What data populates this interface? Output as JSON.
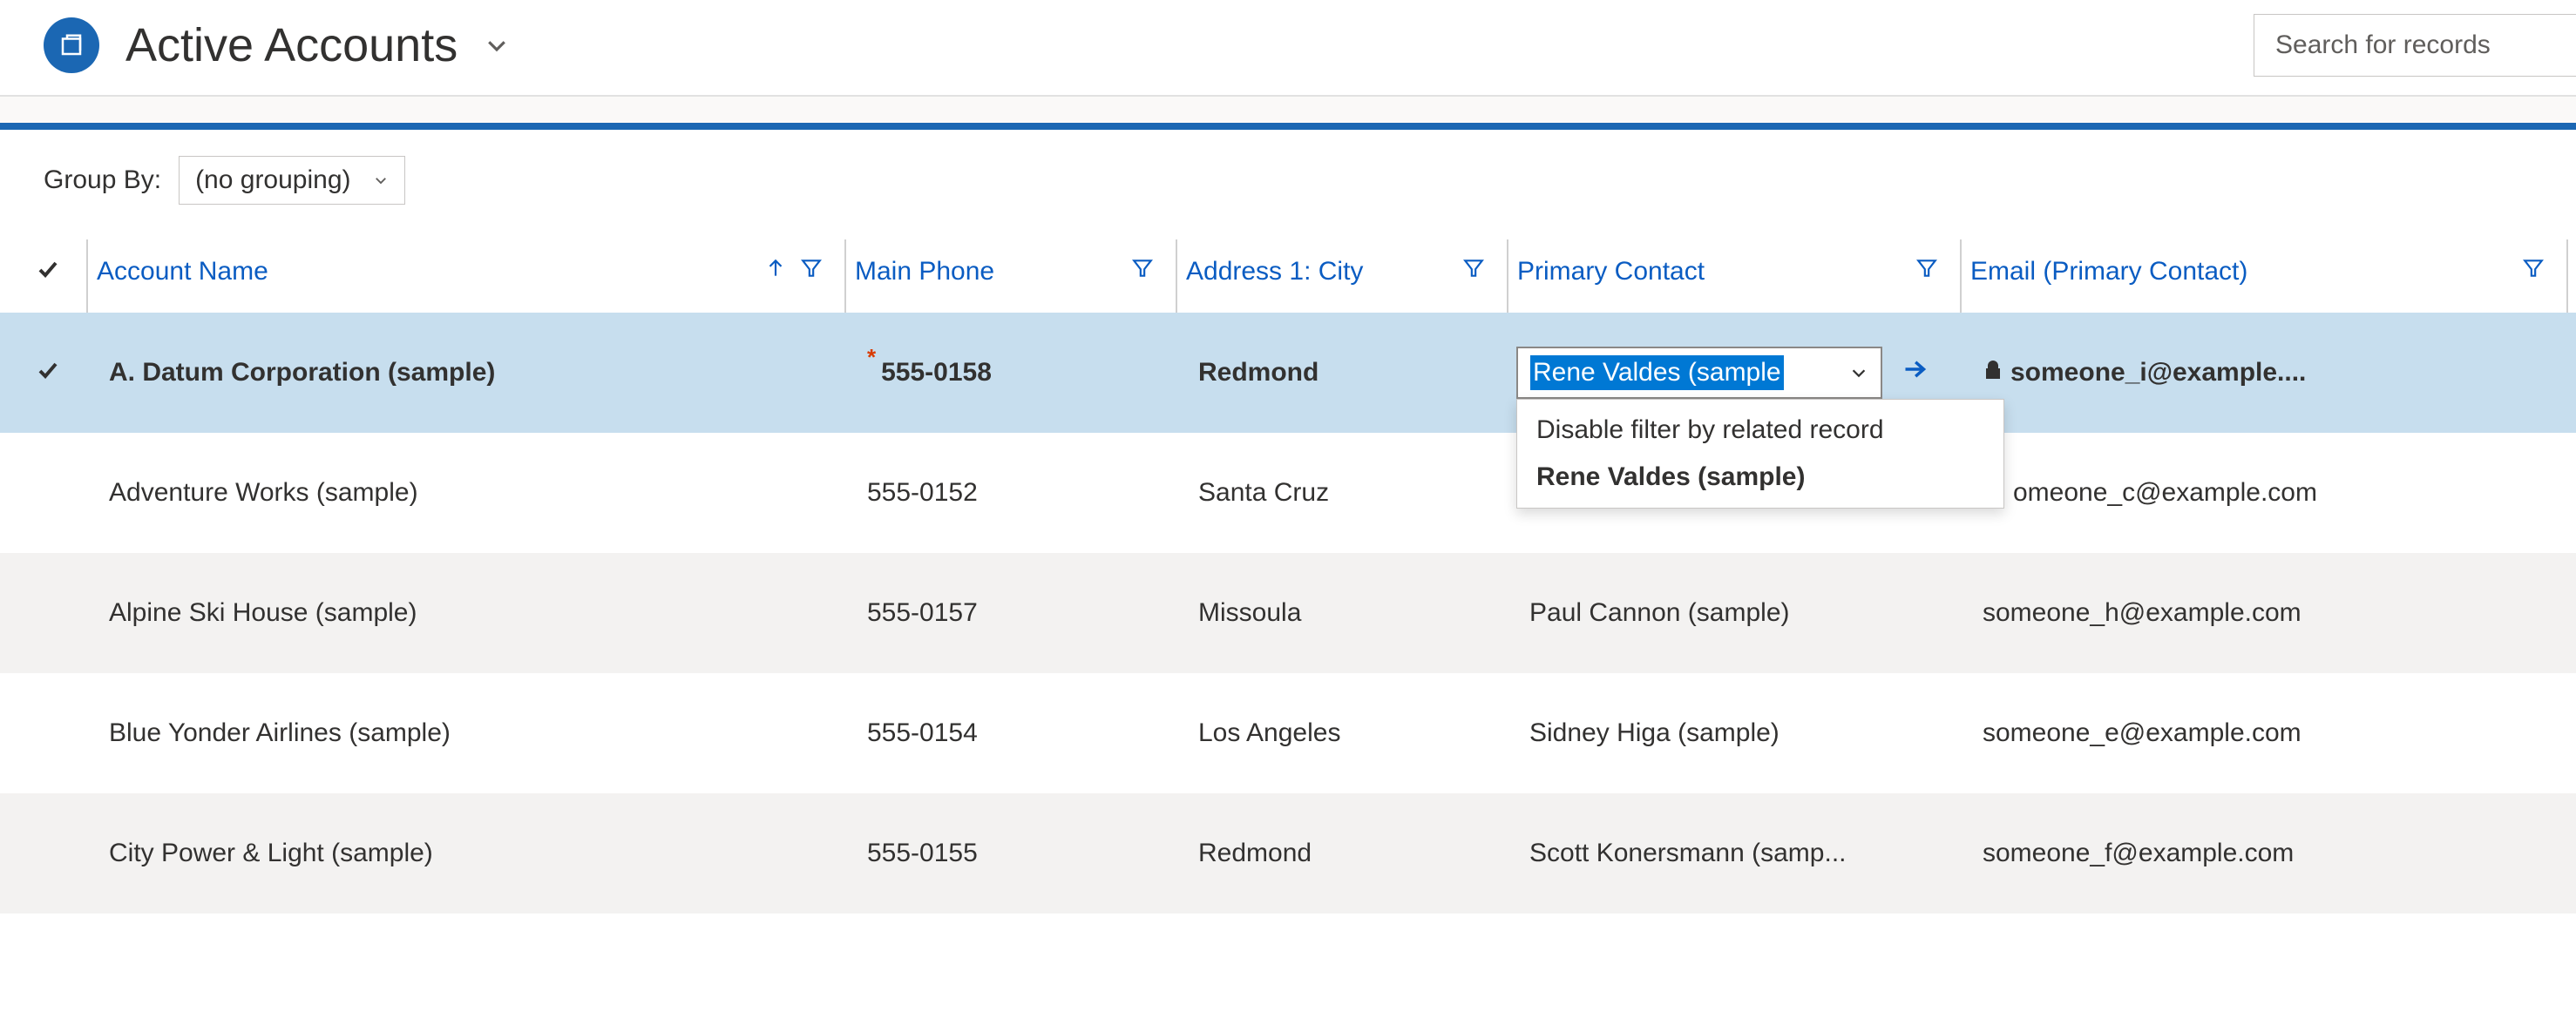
{
  "header": {
    "title": "Active Accounts",
    "search_placeholder": "Search for records"
  },
  "groupby": {
    "label": "Group By:",
    "selected": "(no grouping)"
  },
  "columns": {
    "account_name": "Account Name",
    "main_phone": "Main Phone",
    "address_city": "Address 1: City",
    "primary_contact": "Primary Contact",
    "email_primary": "Email (Primary Contact)"
  },
  "editor": {
    "combo_value": "Rene Valdes (sample",
    "dropdown": {
      "option_disable": "Disable filter by related record",
      "option_selected": "Rene Valdes (sample)"
    }
  },
  "rows": [
    {
      "selected": true,
      "name": "A. Datum Corporation (sample)",
      "phone": "555-0158",
      "city": "Redmond",
      "contact": "Rene Valdes (sample)",
      "email": "someone_i@example...."
    },
    {
      "selected": false,
      "name": "Adventure Works (sample)",
      "phone": "555-0152",
      "city": "Santa Cruz",
      "contact": "",
      "email": "omeone_c@example.com"
    },
    {
      "selected": false,
      "name": "Alpine Ski House (sample)",
      "phone": "555-0157",
      "city": "Missoula",
      "contact": "Paul Cannon (sample)",
      "email": "someone_h@example.com"
    },
    {
      "selected": false,
      "name": "Blue Yonder Airlines (sample)",
      "phone": "555-0154",
      "city": "Los Angeles",
      "contact": "Sidney Higa (sample)",
      "email": "someone_e@example.com"
    },
    {
      "selected": false,
      "name": "City Power & Light (sample)",
      "phone": "555-0155",
      "city": "Redmond",
      "contact": "Scott Konersmann (samp...",
      "email": "someone_f@example.com"
    }
  ]
}
